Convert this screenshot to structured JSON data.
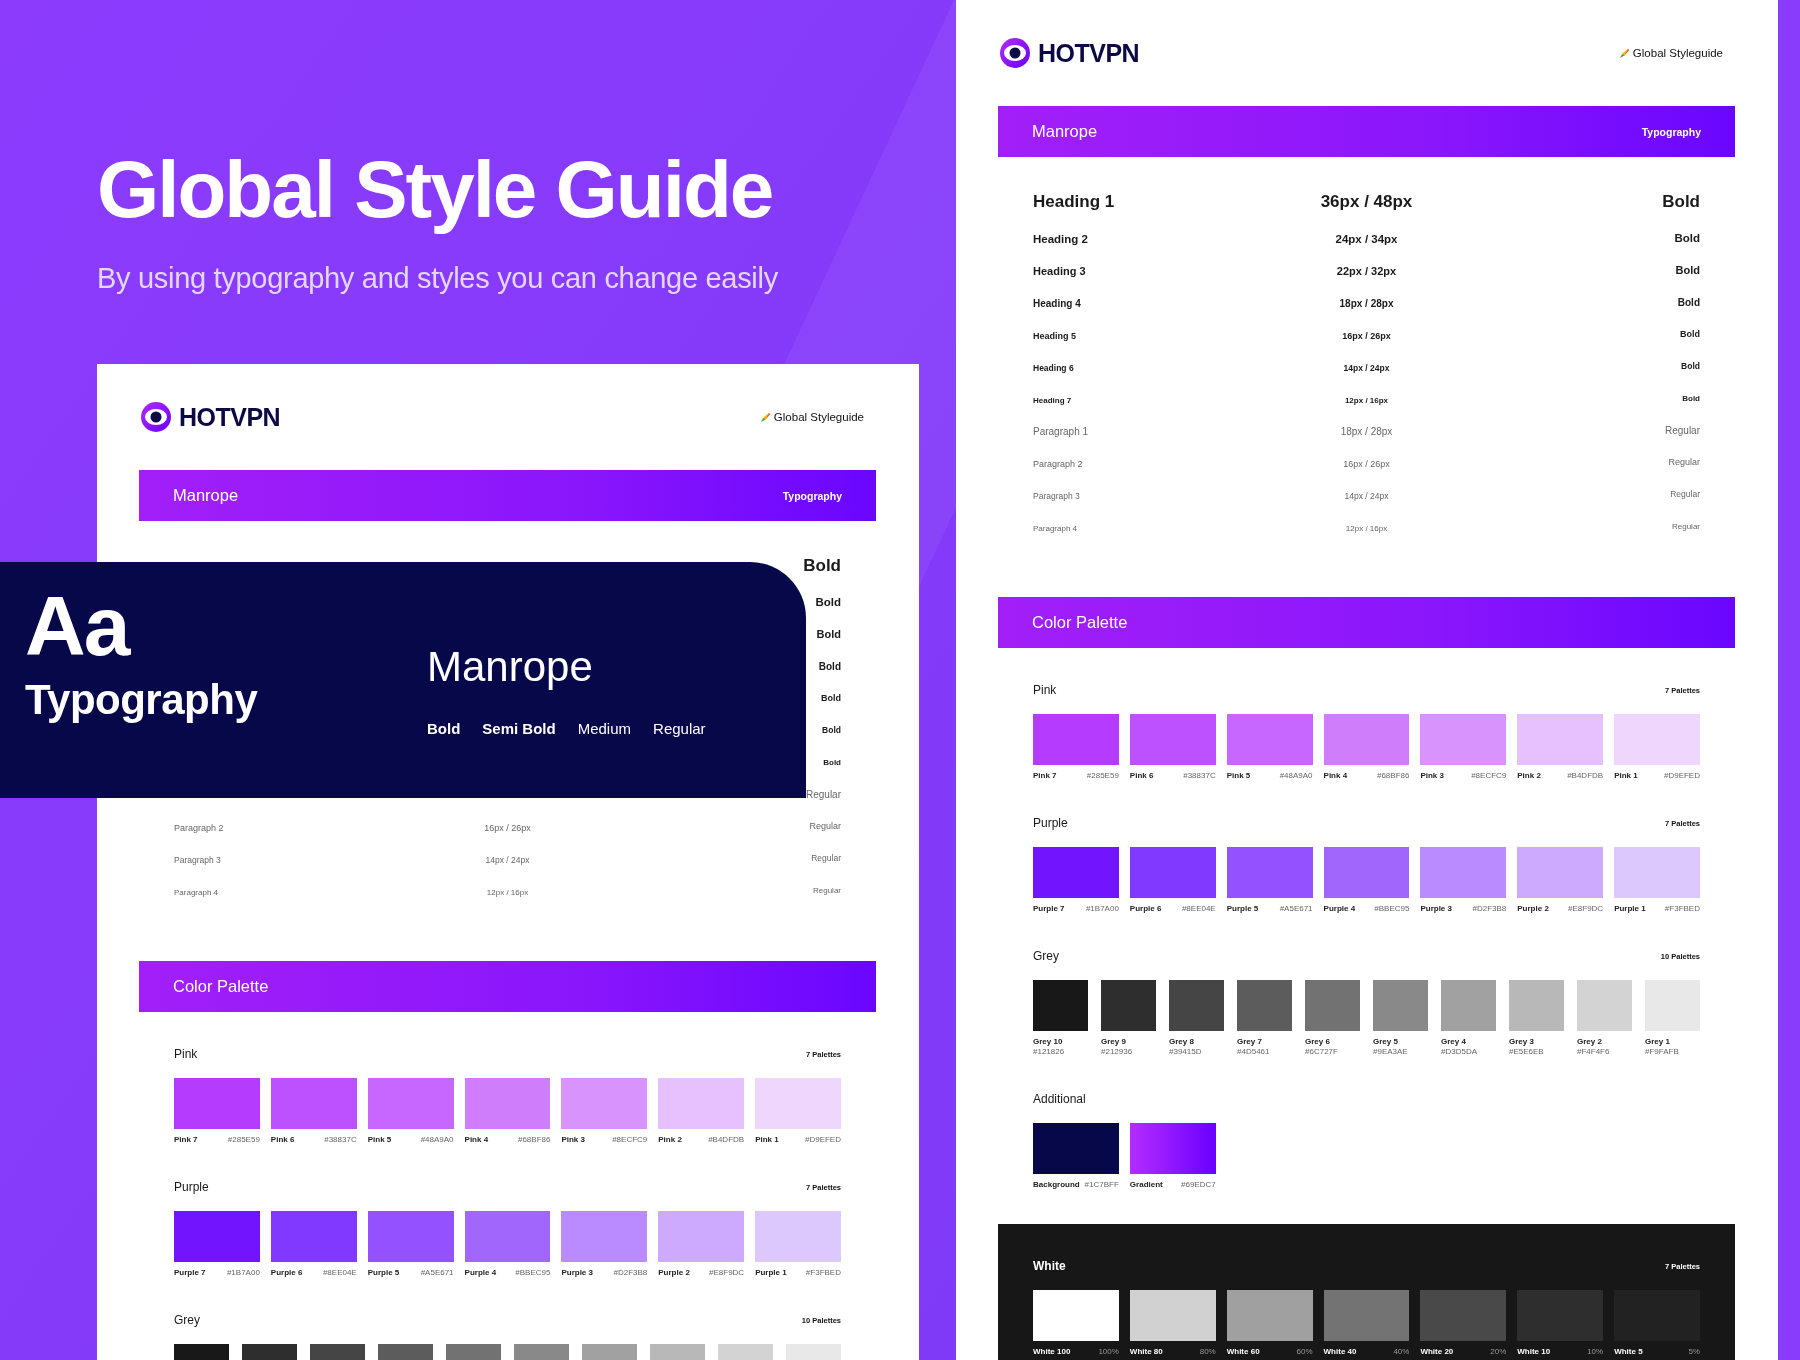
{
  "hero": {
    "title": "Global Style Guide",
    "subtitle": "By using typography and styles you can change easily"
  },
  "overlay": {
    "glyphs": "Aa",
    "label": "Typography",
    "font": "Manrope",
    "weights": [
      {
        "label": "Bold",
        "kind": "bold"
      },
      {
        "label": "Semi Bold",
        "kind": "semibold"
      },
      {
        "label": "Medium",
        "kind": "medium"
      },
      {
        "label": "Regular",
        "kind": "regular"
      }
    ]
  },
  "pages": [
    {
      "brand": "HOTVPN",
      "link": "Global Styleguide",
      "typography": {
        "title": "Manrope",
        "tag": "Typography",
        "rows": [
          {
            "kind": "heading",
            "weight": "Bold"
          },
          {
            "kind": "heading",
            "weight": "Bold"
          },
          {
            "kind": "heading",
            "weight": "Bold"
          },
          {
            "kind": "heading",
            "weight": "Bold"
          },
          {
            "kind": "heading",
            "weight": "Bold"
          },
          {
            "kind": "heading",
            "weight": "Bold"
          },
          {
            "kind": "heading",
            "weight": "Bold"
          },
          {
            "kind": "paragraph",
            "weight": "Regular"
          },
          {
            "kind": "paragraph",
            "name": "Paragraph 2",
            "size": "16px / 26px",
            "weight": "Regular"
          },
          {
            "kind": "paragraph",
            "name": "Paragraph 3",
            "size": "14px / 24px",
            "weight": "Regular"
          },
          {
            "kind": "paragraph",
            "name": "Paragraph 4",
            "size": "12px / 16px",
            "weight": "Regular"
          }
        ]
      },
      "palette": {
        "title": "Color Palette",
        "groups": [
          {
            "name": "Pink",
            "count": "7 Palettes",
            "kind": "light",
            "swatches": [
              {
                "name": "Pink 7",
                "code": "#285E59",
                "color": "#b53bff"
              },
              {
                "name": "Pink 6",
                "code": "#38837C",
                "color": "#bd50ff"
              },
              {
                "name": "Pink 5",
                "code": "#48A9A0",
                "color": "#c767ff"
              },
              {
                "name": "Pink 4",
                "code": "#68BF86",
                "color": "#cf7dfb"
              },
              {
                "name": "Pink 3",
                "code": "#8ECFC9",
                "color": "#d894fc"
              },
              {
                "name": "Pink 2",
                "code": "#B4DFDB",
                "color": "#e6c1fd"
              },
              {
                "name": "Pink 1",
                "code": "#D9EFED",
                "color": "#efd6fd"
              }
            ]
          },
          {
            "name": "Purple",
            "count": "7 Palettes",
            "kind": "light",
            "swatches": [
              {
                "name": "Purple 7",
                "code": "#1B7A00",
                "color": "#7314ff"
              },
              {
                "name": "Purple 6",
                "code": "#8EE04E",
                "color": "#8239ff"
              },
              {
                "name": "Purple 5",
                "code": "#A5E671",
                "color": "#9351ff"
              },
              {
                "name": "Purple 4",
                "code": "#BBEC95",
                "color": "#a167fc"
              },
              {
                "name": "Purple 3",
                "code": "#D2F3B8",
                "color": "#b98bff"
              },
              {
                "name": "Purple 2",
                "code": "#E8F9DC",
                "color": "#cdaafd"
              },
              {
                "name": "Purple 1",
                "code": "#F3FBED",
                "color": "#dcc8fd"
              }
            ]
          },
          {
            "name": "Grey",
            "count": "10 Palettes",
            "kind": "light",
            "swatches": [
              {
                "color": "#181818"
              },
              {
                "color": "#2e2e2e"
              },
              {
                "color": "#454545"
              },
              {
                "color": "#5c5c5c"
              },
              {
                "color": "#727272"
              },
              {
                "color": "#898989"
              },
              {
                "color": "#a1a1a1"
              },
              {
                "color": "#b8b8b8"
              },
              {
                "color": "#d3d3d3"
              },
              {
                "color": "#e8e8e8"
              }
            ]
          }
        ]
      }
    },
    {
      "brand": "HOTVPN",
      "link": "Global Styleguide",
      "typography": {
        "title": "Manrope",
        "tag": "Typography",
        "rows": [
          {
            "kind": "heading",
            "name": "Heading 1",
            "size": "36px / 48px",
            "weight": "Bold"
          },
          {
            "kind": "heading",
            "name": "Heading 2",
            "size": "24px / 34px",
            "weight": "Bold"
          },
          {
            "kind": "heading",
            "name": "Heading 3",
            "size": "22px / 32px",
            "weight": "Bold"
          },
          {
            "kind": "heading",
            "name": "Heading 4",
            "size": "18px / 28px",
            "weight": "Bold"
          },
          {
            "kind": "heading",
            "name": "Heading 5",
            "size": "16px / 26px",
            "weight": "Bold"
          },
          {
            "kind": "heading",
            "name": "Heading 6",
            "size": "14px / 24px",
            "weight": "Bold"
          },
          {
            "kind": "heading",
            "name": "Heading 7",
            "size": "12px / 16px",
            "weight": "Bold"
          },
          {
            "kind": "paragraph",
            "name": "Paragraph 1",
            "size": "18px / 28px",
            "weight": "Regular"
          },
          {
            "kind": "paragraph",
            "name": "Paragraph 2",
            "size": "16px / 26px",
            "weight": "Regular"
          },
          {
            "kind": "paragraph",
            "name": "Paragraph 3",
            "size": "14px / 24px",
            "weight": "Regular"
          },
          {
            "kind": "paragraph",
            "name": "Paragraph 4",
            "size": "12px / 16px",
            "weight": "Regular"
          }
        ]
      },
      "palette": {
        "title": "Color Palette",
        "groups": [
          {
            "name": "Pink",
            "count": "7 Palettes",
            "kind": "light",
            "swatches": [
              {
                "name": "Pink 7",
                "code": "#285E59",
                "color": "#b53bff"
              },
              {
                "name": "Pink 6",
                "code": "#38837C",
                "color": "#bd50ff"
              },
              {
                "name": "Pink 5",
                "code": "#48A9A0",
                "color": "#c767ff"
              },
              {
                "name": "Pink 4",
                "code": "#68BF86",
                "color": "#cf7dfb"
              },
              {
                "name": "Pink 3",
                "code": "#8ECFC9",
                "color": "#d894fc"
              },
              {
                "name": "Pink 2",
                "code": "#B4DFDB",
                "color": "#e6c1fd"
              },
              {
                "name": "Pink 1",
                "code": "#D9EFED",
                "color": "#efd6fd"
              }
            ]
          },
          {
            "name": "Purple",
            "count": "7 Palettes",
            "kind": "light",
            "swatches": [
              {
                "name": "Purple 7",
                "code": "#1B7A00",
                "color": "#7314ff"
              },
              {
                "name": "Purple 6",
                "code": "#8EE04E",
                "color": "#8239ff"
              },
              {
                "name": "Purple 5",
                "code": "#A5E671",
                "color": "#9351ff"
              },
              {
                "name": "Purple 4",
                "code": "#BBEC95",
                "color": "#a167fc"
              },
              {
                "name": "Purple 3",
                "code": "#D2F3B8",
                "color": "#b98bff"
              },
              {
                "name": "Purple 2",
                "code": "#E8F9DC",
                "color": "#cdaafd"
              },
              {
                "name": "Purple 1",
                "code": "#F3FBED",
                "color": "#dcc8fd"
              }
            ]
          },
          {
            "name": "Grey",
            "count": "10 Palettes",
            "kind": "light",
            "swatches": [
              {
                "name": "Grey 10",
                "code": "#121826",
                "color": "#181818"
              },
              {
                "name": "Grey 9",
                "code": "#212936",
                "color": "#2e2e2e"
              },
              {
                "name": "Grey 8",
                "code": "#39415D",
                "color": "#454545"
              },
              {
                "name": "Grey 7",
                "code": "#4D5461",
                "color": "#5c5c5c"
              },
              {
                "name": "Grey 6",
                "code": "#6C727F",
                "color": "#727272"
              },
              {
                "name": "Grey 5",
                "code": "#9EA3AE",
                "color": "#898989"
              },
              {
                "name": "Grey 4",
                "code": "#D3D5DA",
                "color": "#a1a1a1"
              },
              {
                "name": "Grey 3",
                "code": "#E5E6EB",
                "color": "#b8b8b8"
              },
              {
                "name": "Grey 2",
                "code": "#F4F4F6",
                "color": "#d3d3d3"
              },
              {
                "name": "Grey 1",
                "code": "#F9FAFB",
                "color": "#e8e8e8"
              }
            ]
          },
          {
            "name": "Additional",
            "kind": "light",
            "swatches": [
              {
                "name": "Background",
                "code": "#1C7BFF",
                "color": "#070849",
                "kind": "solid"
              },
              {
                "name": "Gradient",
                "code": "#69EDC7",
                "color": "#b52cff",
                "kind": "gradient"
              }
            ]
          },
          {
            "name": "White",
            "count": "7 Palettes",
            "kind": "dark",
            "swatches": [
              {
                "name": "White 100",
                "code": "100%",
                "color": "#ffffff"
              },
              {
                "name": "White 80",
                "code": "80%",
                "color": "#d1d1d1"
              },
              {
                "name": "White 60",
                "code": "60%",
                "color": "#a0a0a0"
              },
              {
                "name": "White 40",
                "code": "40%",
                "color": "#737373"
              },
              {
                "name": "White 20",
                "code": "20%",
                "color": "#494949"
              },
              {
                "name": "White 10",
                "code": "10%",
                "color": "#2e2e2e"
              },
              {
                "name": "White 5",
                "code": "5%",
                "color": "#222222"
              }
            ]
          }
        ]
      }
    }
  ]
}
